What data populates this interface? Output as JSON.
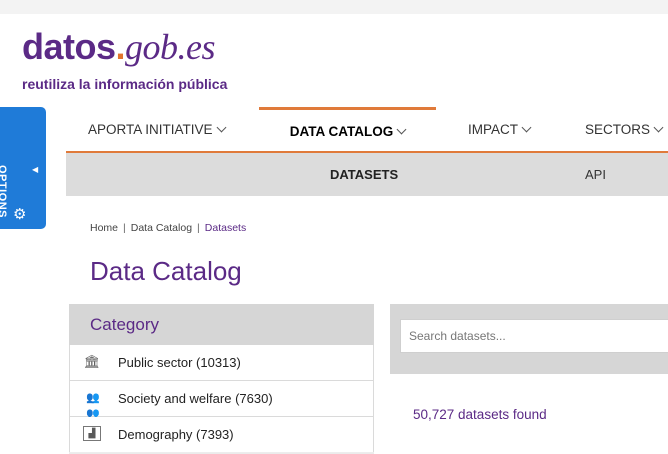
{
  "logo": {
    "datos": "datos",
    "dot": ".",
    "gob": "gob",
    "dot2": ".",
    "es": "es",
    "tagline": "reutiliza la información pública"
  },
  "options_tab": {
    "label": "OPTIONS",
    "arrow_icon": "caret-left-icon",
    "settings_icon": "gear-icon"
  },
  "nav": {
    "items": [
      {
        "label": "APORTA INITIATIVE",
        "active": false
      },
      {
        "label": "DATA CATALOG",
        "active": true
      },
      {
        "label": "IMPACT",
        "active": false
      },
      {
        "label": "SECTORS",
        "active": false
      }
    ]
  },
  "subnav": {
    "items": [
      {
        "label": "DATASETS",
        "active": true
      },
      {
        "label": "API",
        "active": false
      }
    ]
  },
  "breadcrumb": [
    "Home",
    "Data Catalog",
    "Datasets"
  ],
  "page_title": "Data Catalog",
  "sidebar": {
    "header": "Category",
    "items": [
      {
        "icon": "building-columns-icon",
        "label": "Public sector (10313)"
      },
      {
        "icon": "people-group-icon",
        "label": "Society and welfare (7630)"
      },
      {
        "icon": "population-chart-icon",
        "label": "Demography (7393)"
      }
    ]
  },
  "search": {
    "placeholder": "Search datasets..."
  },
  "results": {
    "count_text": "50,727 datasets found"
  },
  "colors": {
    "brand_purple": "#5b2a86",
    "accent_orange": "#e07a3a",
    "options_blue": "#1f7bd8"
  }
}
